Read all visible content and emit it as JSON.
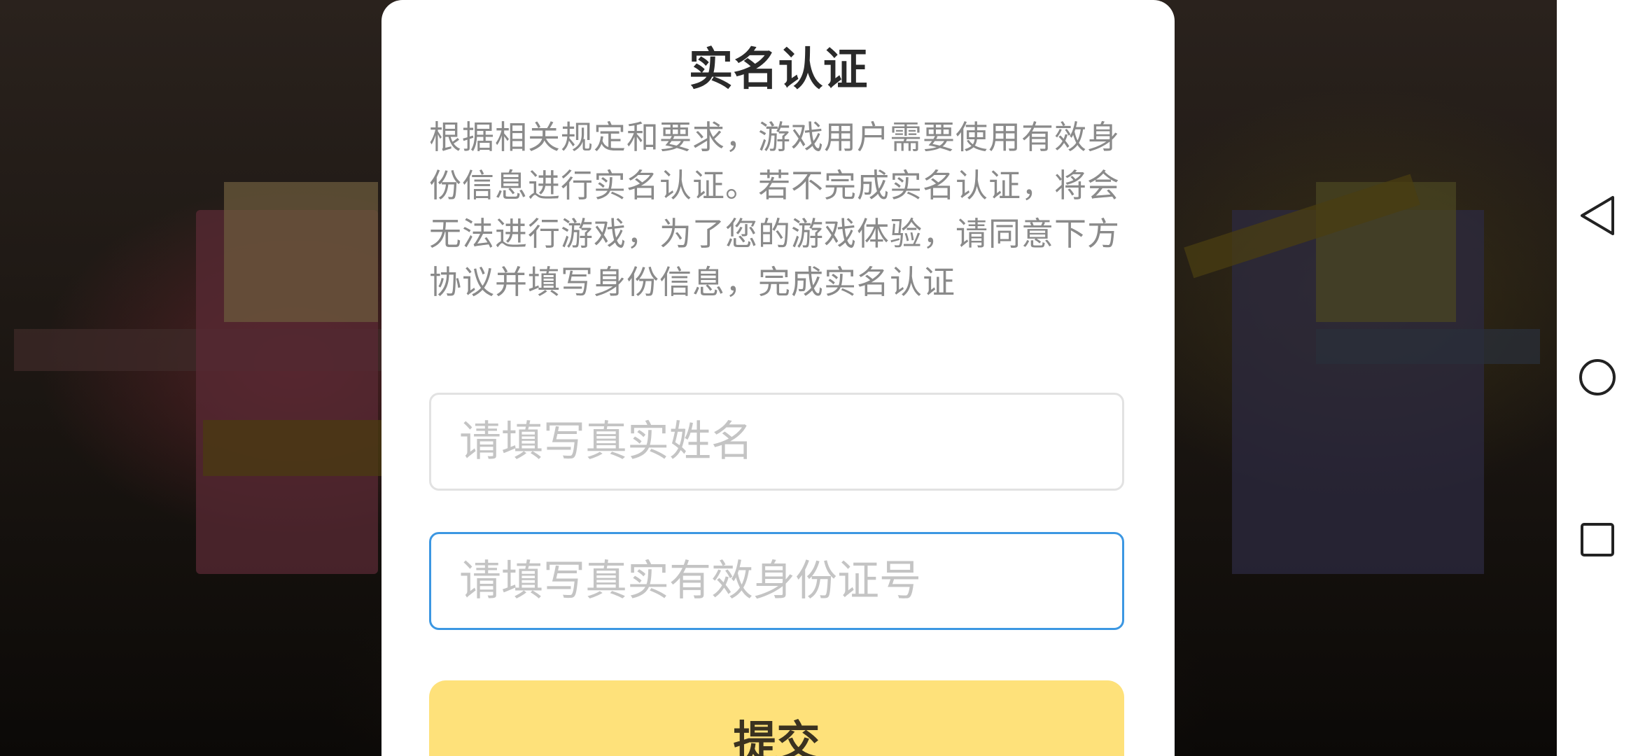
{
  "dialog": {
    "title": "实名认证",
    "description": "根据相关规定和要求，游戏用户需要使用有效身份信息进行实名认证。若不完成实名认证，将会无法进行游戏，为了您的游戏体验，请同意下方协议并填写身份信息，完成实名认证",
    "name_input": {
      "value": "",
      "placeholder": "请填写真实姓名"
    },
    "id_input": {
      "value": "",
      "placeholder": "请填写真实有效身份证号"
    },
    "submit_label": "提交"
  },
  "navbar": {
    "back_icon": "back-triangle-icon",
    "home_icon": "home-circle-icon",
    "recent_icon": "recent-square-icon"
  },
  "colors": {
    "submit_button": "#fee17a",
    "focused_border": "#3c97e2",
    "title": "#2a2a2a",
    "description": "#8a8a8a",
    "placeholder": "#c4c4c4"
  }
}
